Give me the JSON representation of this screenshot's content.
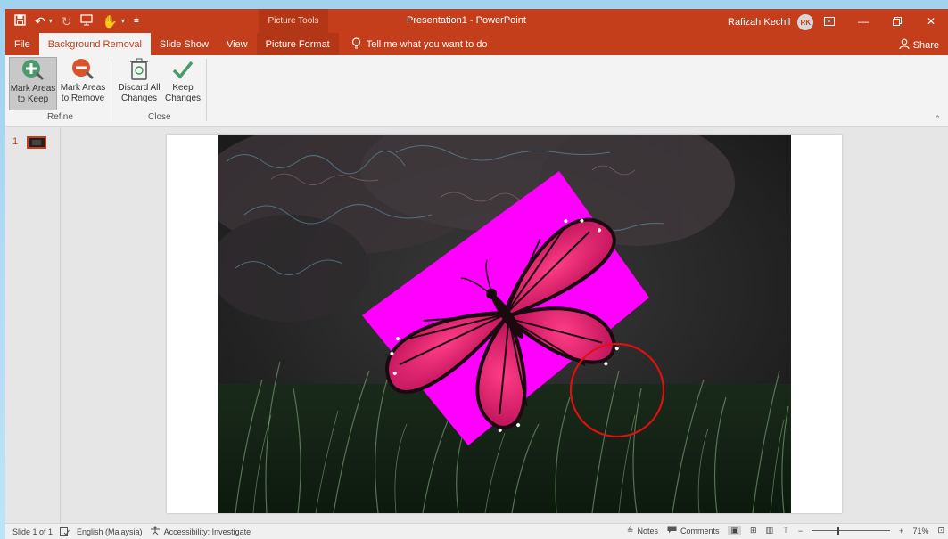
{
  "title_bar": {
    "context_tools": "Picture Tools",
    "document_title": "Presentation1  -  PowerPoint",
    "user_name": "Rafizah Kechil",
    "avatar_initials": "RK"
  },
  "tabs": [
    {
      "label": "File",
      "state": "normal"
    },
    {
      "label": "Background Removal",
      "state": "active"
    },
    {
      "label": "Slide Show",
      "state": "normal"
    },
    {
      "label": "View",
      "state": "normal"
    },
    {
      "label": "Picture Format",
      "state": "context"
    }
  ],
  "tell_me": "Tell me what you want to do",
  "share": "Share",
  "ribbon": {
    "mark_keep": {
      "line1": "Mark Areas",
      "line2": "to Keep"
    },
    "mark_remove": {
      "line1": "Mark Areas",
      "line2": "to Remove"
    },
    "discard": {
      "line1": "Discard All",
      "line2": "Changes"
    },
    "keep": {
      "line1": "Keep",
      "line2": "Changes"
    },
    "group_refine": "Refine",
    "group_close": "Close"
  },
  "thumbnails": {
    "slide_number": "1"
  },
  "status": {
    "slide": "Slide 1 of 1",
    "language": "English (Malaysia)",
    "accessibility": "Accessibility: Investigate",
    "notes": "Notes",
    "comments": "Comments",
    "zoom": "71%"
  },
  "colors": {
    "accent": "#c43e1c",
    "remove_overlay": "#ff00ff",
    "annotation_circle": "#e01010"
  }
}
